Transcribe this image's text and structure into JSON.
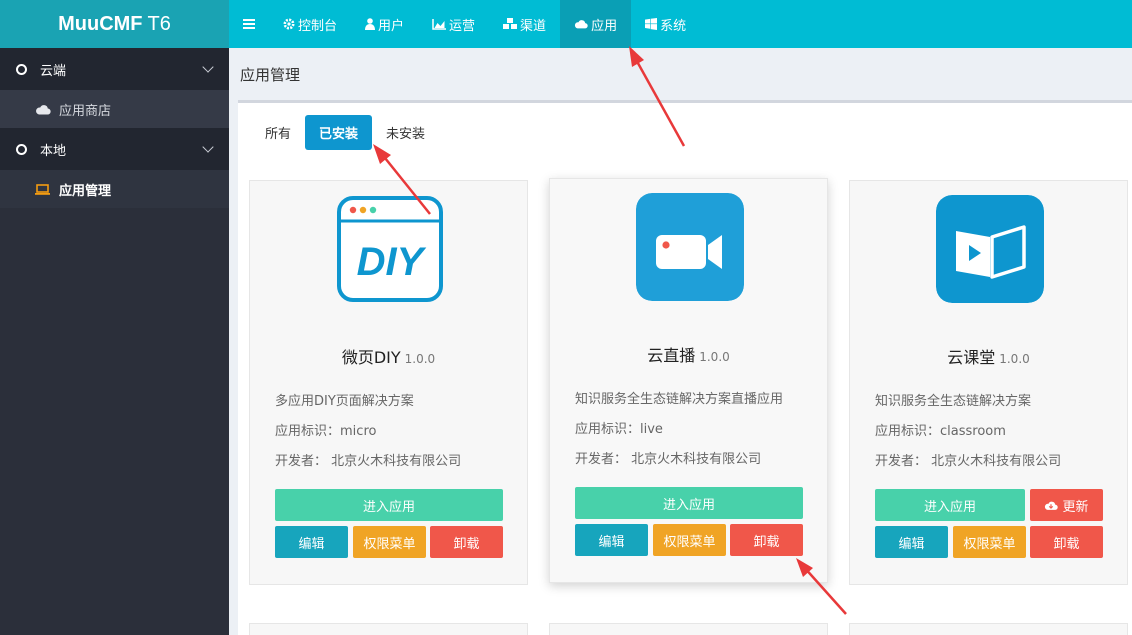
{
  "brand": {
    "bold": "MuuCMF",
    "suffix": "T6"
  },
  "sidebar": {
    "groups": [
      {
        "label": "云端",
        "items": [
          {
            "label": "应用商店",
            "icon": "cloud-icon"
          }
        ]
      },
      {
        "label": "本地",
        "items": [
          {
            "label": "应用管理",
            "icon": "laptop-icon",
            "active": true
          }
        ]
      }
    ]
  },
  "topnav": {
    "items": [
      {
        "label": "控制台",
        "icon": "gear-icon"
      },
      {
        "label": "用户",
        "icon": "user-icon"
      },
      {
        "label": "运营",
        "icon": "chart-icon"
      },
      {
        "label": "渠道",
        "icon": "cubes-icon"
      },
      {
        "label": "应用",
        "icon": "cloud-icon",
        "active": true
      },
      {
        "label": "系统",
        "icon": "windows-icon"
      }
    ]
  },
  "page": {
    "title": "应用管理"
  },
  "tabs": [
    {
      "label": "所有"
    },
    {
      "label": "已安装",
      "active": true
    },
    {
      "label": "未安装"
    }
  ],
  "apps": [
    {
      "name": "微页DIY",
      "version": "1.0.0",
      "description": "多应用DIY页面解决方案",
      "id_label": "应用标识：",
      "id_value": "micro",
      "dev_label": "开发者：",
      "dev_value": "北京火木科技有限公司",
      "enter": "进入应用",
      "edit": "编辑",
      "perm": "权限菜单",
      "uninstall": "卸载"
    },
    {
      "name": "云直播",
      "version": "1.0.0",
      "description": "知识服务全生态链解决方案直播应用",
      "id_label": "应用标识：",
      "id_value": "live",
      "dev_label": "开发者：",
      "dev_value": "北京火木科技有限公司",
      "enter": "进入应用",
      "edit": "编辑",
      "perm": "权限菜单",
      "uninstall": "卸载"
    },
    {
      "name": "云课堂",
      "version": "1.0.0",
      "description": "知识服务全生态链解决方案",
      "id_label": "应用标识：",
      "id_value": "classroom",
      "dev_label": "开发者：",
      "dev_value": "北京火木科技有限公司",
      "enter": "进入应用",
      "update": "更新",
      "edit": "编辑",
      "perm": "权限菜单",
      "uninstall": "卸载"
    }
  ],
  "colors": {
    "topbar": "#00bcd4",
    "brand_bg": "#1aa3b3",
    "sidebar": "#2b2f3a",
    "enter": "#48d1aa",
    "edit": "#17a5bd",
    "perm": "#f0a425",
    "danger": "#f0574a",
    "tab_active": "#0e96cf",
    "annotation_arrow": "#e8393a"
  }
}
